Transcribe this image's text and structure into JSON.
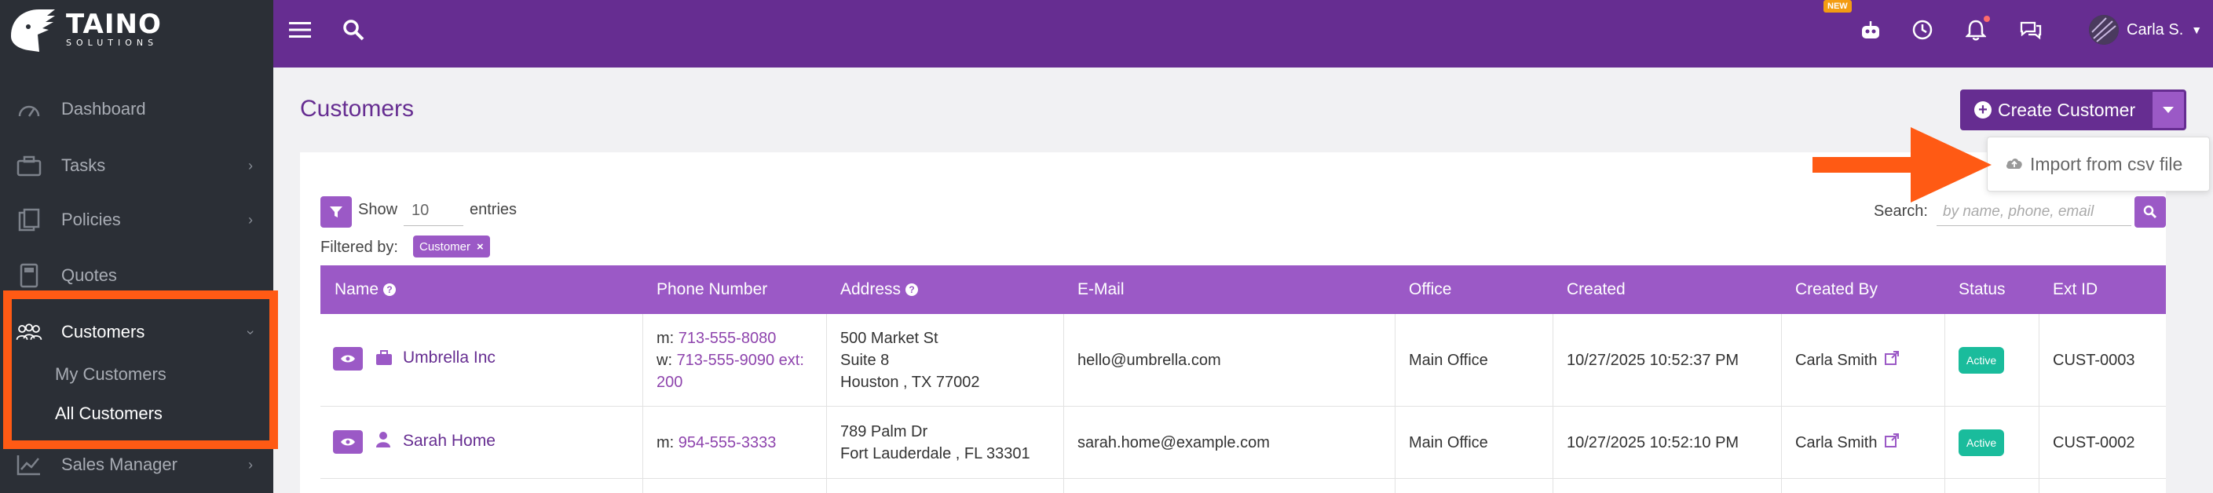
{
  "brand": {
    "name": "TAINO",
    "tagline": "SOLUTIONS"
  },
  "sidebar": {
    "items": [
      {
        "label": "Dashboard",
        "icon": "dashboard-icon",
        "chevron": false
      },
      {
        "label": "Tasks",
        "icon": "tasks-icon",
        "chevron": true
      },
      {
        "label": "Policies",
        "icon": "policies-icon",
        "chevron": true
      },
      {
        "label": "Quotes",
        "icon": "quotes-icon",
        "chevron": false
      },
      {
        "label": "Customers",
        "icon": "customers-icon",
        "chevron": true,
        "active": true
      },
      {
        "label": "Sales Manager",
        "icon": "sales-icon",
        "chevron": true
      }
    ],
    "submenu": [
      {
        "label": "My Customers"
      },
      {
        "label": "All Customers",
        "active": true
      }
    ]
  },
  "topbar": {
    "new_badge": "NEW",
    "user_name": "Carla S."
  },
  "page": {
    "title": "Customers",
    "create_button": "Create Customer",
    "dropdown_item": "Import from csv file"
  },
  "controls": {
    "show_label": "Show",
    "entries_value": "10",
    "entries_label": "entries",
    "filtered_label": "Filtered by:",
    "filter_tag": "Customer",
    "search_label": "Search:",
    "search_placeholder": "by name, phone, email"
  },
  "table": {
    "headers": [
      "Name",
      "Phone Number",
      "Address",
      "E-Mail",
      "Office",
      "Created",
      "Created By",
      "Status",
      "Ext ID"
    ],
    "rows": [
      {
        "name": "Umbrella Inc",
        "type": "business",
        "phone_m_prefix": "m:",
        "phone_m": "713-555-8080",
        "phone_w_prefix": "w:",
        "phone_w": "713-555-9090 ext: 200",
        "address1": "500 Market St",
        "address2": "Suite 8",
        "address3": "Houston , TX 77002",
        "email": "hello@umbrella.com",
        "office": "Main Office",
        "created": "10/27/2025 10:52:37 PM",
        "created_by": "Carla Smith",
        "status": "Active",
        "ext_id": "CUST-0003"
      },
      {
        "name": "Sarah Home",
        "type": "person",
        "phone_m_prefix": "m:",
        "phone_m": "954-555-3333",
        "address1": "789 Palm Dr",
        "address2": "Fort Lauderdale , FL 33301",
        "email": "sarah.home@example.com",
        "office": "Main Office",
        "created": "10/27/2025 10:52:10 PM",
        "created_by": "Carla Smith",
        "status": "Active",
        "ext_id": "CUST-0002"
      }
    ]
  },
  "colors": {
    "brand_purple": "#662d91",
    "light_purple": "#9b59c6",
    "sidebar_bg": "#2b2f36",
    "highlight_orange": "#ff5a14",
    "active_green": "#1abc9c"
  }
}
